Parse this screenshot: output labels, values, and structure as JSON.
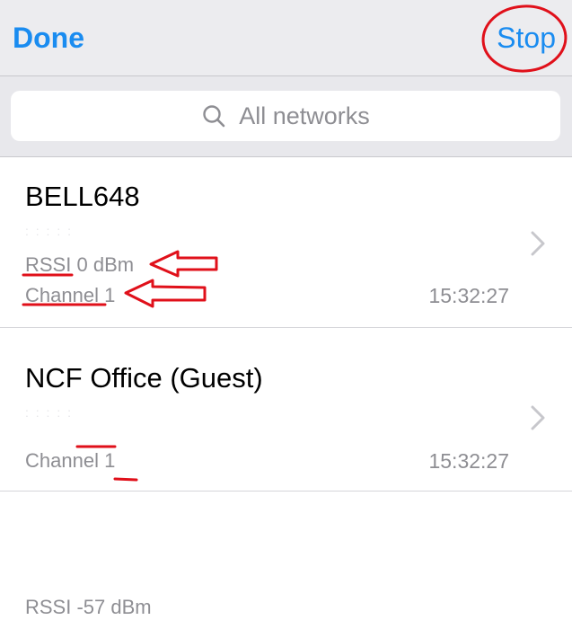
{
  "navbar": {
    "done_label": "Done",
    "stop_label": "Stop"
  },
  "search": {
    "placeholder": "All networks"
  },
  "networks": [
    {
      "ssid": "BELL648",
      "mac": ":  :  :  :  :",
      "rssi_label": "RSSI",
      "rssi_value": "0 dBm",
      "channel_label": "Channel",
      "channel_value": "1",
      "time": "15:32:27"
    },
    {
      "ssid": "NCF Office (Guest)",
      "mac": ":  :  :  :  :",
      "rssi_label": "RSSI",
      "rssi_value": "-57 dBm",
      "channel_label": "Channel",
      "channel_value": "1",
      "time": "15:32:27"
    }
  ],
  "colors": {
    "accent": "#1a8cf0",
    "annotation": "#e0101a",
    "secondary_text": "#8e8e93"
  },
  "icons": {
    "search": "search-icon",
    "chevron": "chevron-right-icon"
  }
}
